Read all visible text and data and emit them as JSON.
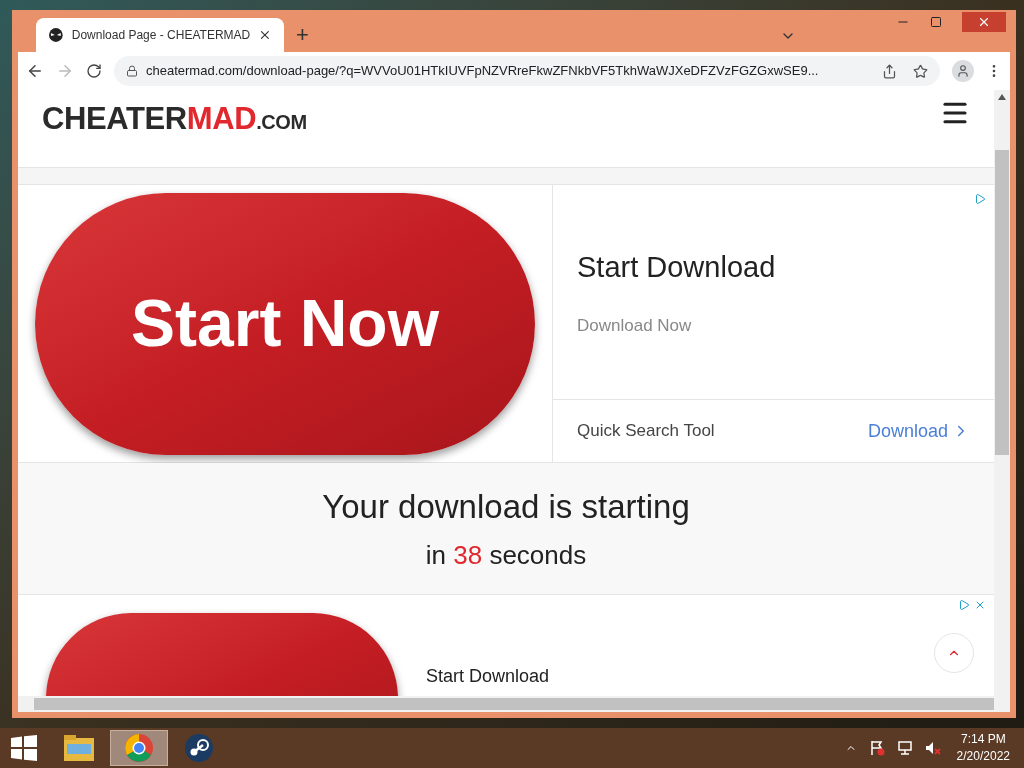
{
  "browser": {
    "tab": {
      "title": "Download Page - CHEATERMAD",
      "selected": true
    },
    "new_tab": "+",
    "address": "cheatermad.com/download-page/?q=WVVoU01HTkIUVFpNZVRreFkwZFNkbVF5TkhWaWJXeDFZVzFGZGxwSE9..."
  },
  "site": {
    "logo": {
      "main": "CHEATER",
      "accent": "MAD",
      "suffix": ".COM"
    }
  },
  "ad_top": {
    "button": "Start Now",
    "title": "Start Download",
    "subtitle": "Download Now",
    "footer_label": "Quick Search Tool",
    "footer_link": "Download"
  },
  "countdown": {
    "heading": "Your download is starting",
    "prefix": "in",
    "count": "38",
    "suffix": "seconds"
  },
  "ad_bottom": {
    "title": "Start Download"
  },
  "taskbar": {
    "apps": [
      {
        "kind": "explorer",
        "selected": false
      },
      {
        "kind": "chrome",
        "selected": true
      },
      {
        "kind": "steam",
        "selected": false
      }
    ],
    "time": "7:14 PM",
    "date": "2/20/2022"
  }
}
